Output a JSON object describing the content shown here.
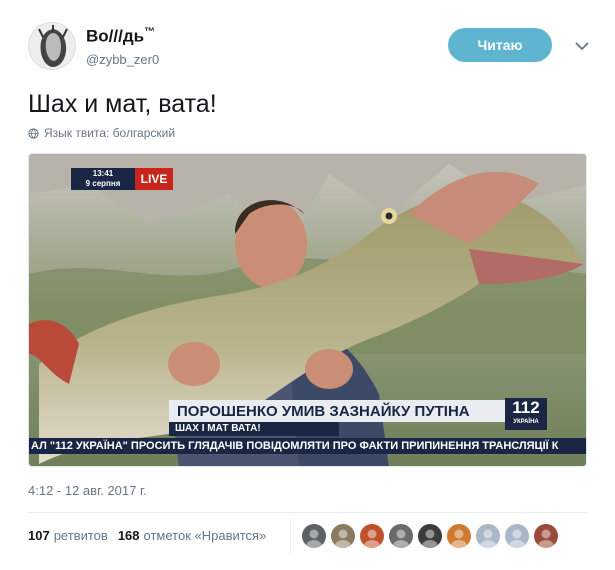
{
  "user": {
    "display_name": "Во///дь",
    "display_name_tm": "™",
    "username": "@zybb_zer0"
  },
  "follow_label": "Читаю",
  "tweet": {
    "text": "Шах и мат, вата!",
    "language": "Язык твита: болгарский"
  },
  "media": {
    "time": "13:41",
    "date": "9 серпня",
    "live": "LIVE",
    "headline": "ПОРОШЕНКО УМИВ ЗАЗНАЙКУ ПУТІНА",
    "subhead": "ШАХ І МАТ ВАТА!",
    "channel_number": "112",
    "channel_name": "УКРАЇНА",
    "ticker": "АЛ \"112 УКРАЇНА\" ПРОСИТЬ ГЛЯДАЧІВ ПОВІДОМЛЯТИ ПРО ФАКТИ ПРИПИНЕННЯ ТРАНСЛЯЦІЇ К"
  },
  "timestamp": "4:12 - 12 авг. 2017 г.",
  "stats": {
    "retweets_count": "107",
    "retweets_label": "ретвитов",
    "likes_count": "168",
    "likes_label": "отметок «Нравится»"
  },
  "likers": [
    {
      "color": "#5a6066"
    },
    {
      "color": "#8a7a60"
    },
    {
      "color": "#c0502a"
    },
    {
      "color": "#6a6a6a"
    },
    {
      "color": "#3c3c3c"
    },
    {
      "color": "#d07a30"
    },
    {
      "color": "#a9b7c6"
    },
    {
      "color": "#a9b7c6"
    },
    {
      "color": "#9a4a3a"
    }
  ],
  "colors": {
    "follow": "#5fb5cf",
    "channel_navy": "#1a2744",
    "live_red": "#c9241b",
    "muted": "#657786"
  }
}
